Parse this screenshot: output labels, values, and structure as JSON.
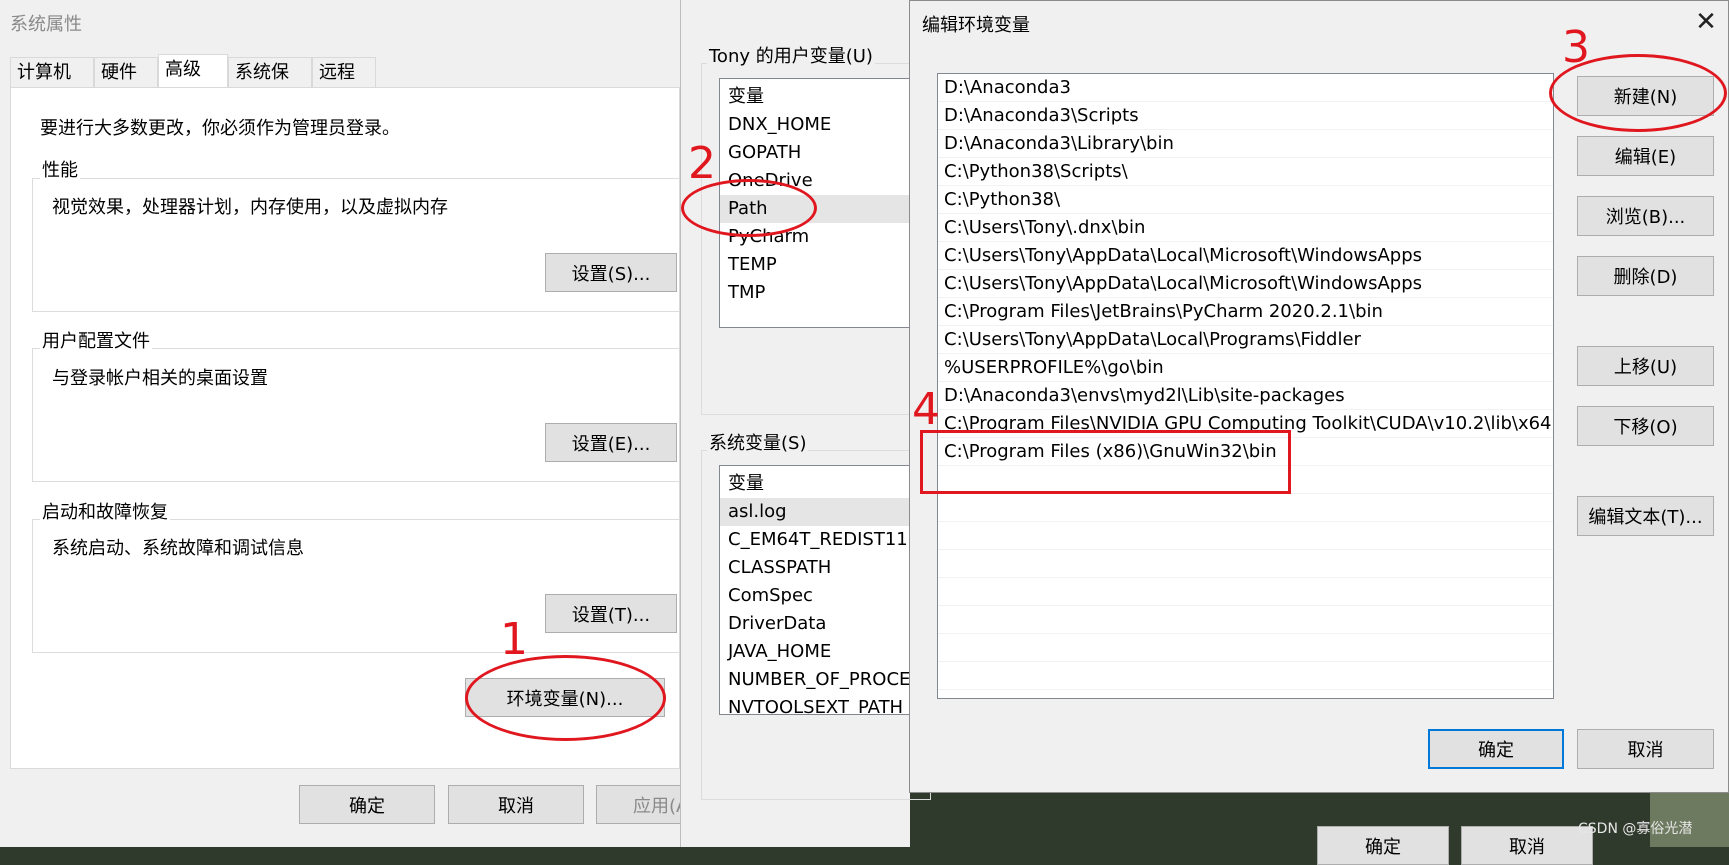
{
  "sys_props": {
    "title": "系统属性",
    "tabs": [
      "计算机名",
      "硬件",
      "高级",
      "系统保护",
      "远程"
    ],
    "admin_note": "要进行大多数更改，你必须作为管理员登录。",
    "performance": {
      "label": "性能",
      "desc": "视觉效果，处理器计划，内存使用，以及虚拟内存",
      "button": "设置(S)..."
    },
    "profiles": {
      "label": "用户配置文件",
      "desc": "与登录帐户相关的桌面设置",
      "button": "设置(E)..."
    },
    "startup": {
      "label": "启动和故障恢复",
      "desc": "系统启动、系统故障和调试信息",
      "button": "设置(T)..."
    },
    "env_button": "环境变量(N)...",
    "ok": "确定",
    "cancel": "取消",
    "apply": "应用(A"
  },
  "env_vars": {
    "user_label": "Tony 的用户变量(U)",
    "user_header": "变量",
    "user_vars": [
      "DNX_HOME",
      "GOPATH",
      "OneDrive",
      "Path",
      "PyCharm",
      "TEMP",
      "TMP"
    ],
    "selected_user_var": "Path",
    "system_label": "系统变量(S)",
    "system_header": "变量",
    "system_vars": [
      "asl.log",
      "C_EM64T_REDIST11",
      "CLASSPATH",
      "ComSpec",
      "DriverData",
      "JAVA_HOME",
      "NUMBER_OF_PROCE",
      "NVTOOLSEXT_PATH"
    ],
    "ok": "确定",
    "cancel": "取消"
  },
  "edit_env": {
    "title": "编辑环境变量",
    "close_icon": "close-icon",
    "paths": [
      "D:\\Anaconda3",
      "D:\\Anaconda3\\Scripts",
      "D:\\Anaconda3\\Library\\bin",
      "C:\\Python38\\Scripts\\",
      "C:\\Python38\\",
      "C:\\Users\\Tony\\.dnx\\bin",
      "C:\\Users\\Tony\\AppData\\Local\\Microsoft\\WindowsApps",
      "C:\\Users\\Tony\\AppData\\Local\\Microsoft\\WindowsApps",
      "C:\\Program Files\\JetBrains\\PyCharm 2020.2.1\\bin",
      "C:\\Users\\Tony\\AppData\\Local\\Programs\\Fiddler",
      "%USERPROFILE%\\go\\bin",
      "D:\\Anaconda3\\envs\\myd2l\\Lib\\site-packages",
      "C:\\Program Files\\NVIDIA GPU Computing Toolkit\\CUDA\\v10.2\\lib\\x64",
      "C:\\Program Files (x86)\\GnuWin32\\bin"
    ],
    "buttons": {
      "new": "新建(N)",
      "edit": "编辑(E)",
      "browse": "浏览(B)...",
      "delete": "删除(D)",
      "up": "上移(U)",
      "down": "下移(O)",
      "edit_text": "编辑文本(T)...",
      "ok": "确定",
      "cancel": "取消"
    }
  },
  "annotations": {
    "n1": "1",
    "n2": "2",
    "n3": "3",
    "n4": "4"
  },
  "watermark": "CSDN @寡俗光潜",
  "colors": {
    "annotation_red": "#e0171f",
    "default_button_border": "#0078d7"
  }
}
